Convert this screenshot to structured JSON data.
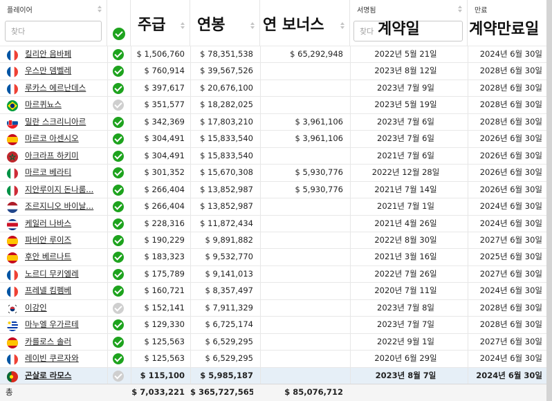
{
  "columns": {
    "player": "플레이어",
    "player_filter_placeholder": "찾다",
    "weekly": "주급",
    "annual": "연봉",
    "bonus": "연 보너스",
    "signed_small": "서명됨",
    "signed_filter_placeholder": "찾다",
    "signed_big": "계약일",
    "expiry_small": "만료",
    "expiry_big": "계약만료일"
  },
  "colors": {
    "check_on": "#1ea31e",
    "check_off": "#cfcfcf",
    "selected_row": "#e6eff7"
  },
  "rows": [
    {
      "name": "킬리안 음바페",
      "flag": "france-flag",
      "active": true,
      "weekly": "$ 1,506,760",
      "annual": "$ 78,351,538",
      "bonus": "$ 65,292,948",
      "signed": "2022년 5월 21일",
      "expiry": "2024년 6월 30일"
    },
    {
      "name": "우스만 뎀벨레",
      "flag": "france-flag",
      "active": true,
      "weekly": "$ 760,914",
      "annual": "$ 39,567,526",
      "bonus": "",
      "signed": "2023년 8월 12일",
      "expiry": "2028년 6월 30일"
    },
    {
      "name": "루카스 에르난데스",
      "flag": "france-flag",
      "active": true,
      "weekly": "$ 397,617",
      "annual": "$ 20,676,100",
      "bonus": "",
      "signed": "2023년 7월 9일",
      "expiry": "2028년 6월 30일"
    },
    {
      "name": "마르퀴뇨스",
      "flag": "brazil-flag",
      "active": false,
      "weekly": "$ 351,577",
      "annual": "$ 18,282,025",
      "bonus": "",
      "signed": "2023년 5월 19일",
      "expiry": "2028년 6월 30일"
    },
    {
      "name": "밀란 스크리니아르",
      "flag": "slovakia-flag",
      "active": true,
      "weekly": "$ 342,369",
      "annual": "$ 17,803,210",
      "bonus": "$ 3,961,106",
      "signed": "2023년 7월 6일",
      "expiry": "2028년 6월 30일"
    },
    {
      "name": "마르코 아센시오",
      "flag": "spain-flag",
      "active": true,
      "weekly": "$ 304,491",
      "annual": "$ 15,833,540",
      "bonus": "$ 3,961,106",
      "signed": "2023년 7월 6일",
      "expiry": "2026년 6월 30일"
    },
    {
      "name": "아크라프 하키미",
      "flag": "morocco-flag",
      "active": true,
      "weekly": "$ 304,491",
      "annual": "$ 15,833,540",
      "bonus": "",
      "signed": "2021년 7월 6일",
      "expiry": "2026년 6월 30일"
    },
    {
      "name": "마르코 베라티",
      "flag": "italy-flag",
      "active": true,
      "weekly": "$ 301,352",
      "annual": "$ 15,670,308",
      "bonus": "$ 5,930,776",
      "signed": "2022년 12월 28일",
      "expiry": "2026년 6월 30일"
    },
    {
      "name": "지안루이지 돈나룸...",
      "flag": "italy-flag",
      "active": true,
      "weekly": "$ 266,404",
      "annual": "$ 13,852,987",
      "bonus": "$ 5,930,776",
      "signed": "2021년 7월 14일",
      "expiry": "2026년 6월 30일"
    },
    {
      "name": "조르지니오 바이날...",
      "flag": "netherlands-flag",
      "active": true,
      "weekly": "$ 266,404",
      "annual": "$ 13,852,987",
      "bonus": "",
      "signed": "2021년 7월 1일",
      "expiry": "2024년 6월 30일"
    },
    {
      "name": "케일러 나바스",
      "flag": "costa-rica-flag",
      "active": true,
      "weekly": "$ 228,316",
      "annual": "$ 11,872,434",
      "bonus": "",
      "signed": "2021년 4월 26일",
      "expiry": "2024년 6월 30일"
    },
    {
      "name": "파비안 루이즈",
      "flag": "spain-flag",
      "active": true,
      "weekly": "$ 190,229",
      "annual": "$ 9,891,882",
      "bonus": "",
      "signed": "2022년 8월 30일",
      "expiry": "2027년 6월 30일"
    },
    {
      "name": "후안 베르나트",
      "flag": "spain-flag",
      "active": true,
      "weekly": "$ 183,323",
      "annual": "$ 9,532,770",
      "bonus": "",
      "signed": "2021년 3월 16일",
      "expiry": "2025년 6월 30일"
    },
    {
      "name": "노르디 무키엘레",
      "flag": "france-flag",
      "active": true,
      "weekly": "$ 175,789",
      "annual": "$ 9,141,013",
      "bonus": "",
      "signed": "2022년 7월 26일",
      "expiry": "2027년 6월 30일"
    },
    {
      "name": "프레넬 킴펨베",
      "flag": "france-flag",
      "active": true,
      "weekly": "$ 160,721",
      "annual": "$ 8,357,497",
      "bonus": "",
      "signed": "2020년 7월 11일",
      "expiry": "2024년 6월 30일"
    },
    {
      "name": "이강인",
      "flag": "south-korea-flag",
      "active": false,
      "weekly": "$ 152,141",
      "annual": "$ 7,911,329",
      "bonus": "",
      "signed": "2023년 7월 8일",
      "expiry": "2028년 6월 30일"
    },
    {
      "name": "마누엘 우가르테",
      "flag": "uruguay-flag",
      "active": true,
      "weekly": "$ 129,330",
      "annual": "$ 6,725,174",
      "bonus": "",
      "signed": "2023년 7월 7일",
      "expiry": "2028년 6월 30일"
    },
    {
      "name": "카를로스 솔러",
      "flag": "spain-flag",
      "active": true,
      "weekly": "$ 125,563",
      "annual": "$ 6,529,295",
      "bonus": "",
      "signed": "2022년 9월 1일",
      "expiry": "2027년 6월 30일"
    },
    {
      "name": "레이빈 쿠르자와",
      "flag": "france-flag",
      "active": true,
      "weekly": "$ 125,563",
      "annual": "$ 6,529,295",
      "bonus": "",
      "signed": "2020년 6월 29일",
      "expiry": "2024년 6월 30일"
    },
    {
      "name": "곤살로 라모스",
      "flag": "portugal-flag",
      "active": false,
      "weekly": "$ 115,100",
      "annual": "$ 5,985,187",
      "bonus": "",
      "signed": "2023년 8월 7일",
      "expiry": "2024년 6월 30일",
      "selected": true
    }
  ],
  "totals": {
    "label": "총",
    "weekly": "$ 7,033,221",
    "annual": "$ 365,727,565",
    "bonus": "$ 85,076,712"
  }
}
